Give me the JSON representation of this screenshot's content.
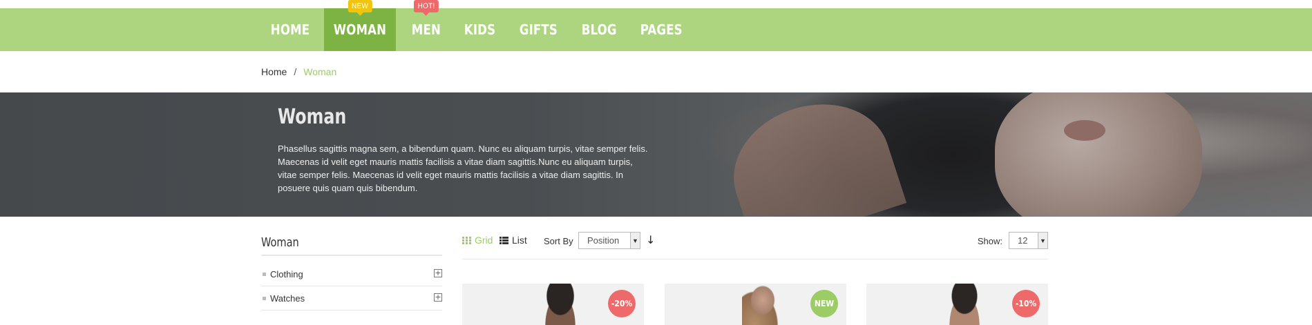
{
  "nav": {
    "items": [
      {
        "label": "HOME",
        "badge": ""
      },
      {
        "label": "WOMAN",
        "badge": "NEW",
        "active": true
      },
      {
        "label": "MEN",
        "badge": "HOT!"
      },
      {
        "label": "KIDS",
        "badge": ""
      },
      {
        "label": "GIFTS",
        "badge": ""
      },
      {
        "label": "BLOG",
        "badge": ""
      },
      {
        "label": "PAGES",
        "badge": ""
      }
    ],
    "colors": {
      "bar": "#add580",
      "active": "#7cb342",
      "new_badge": "#f2c40a",
      "hot_badge": "#ee6a6a"
    }
  },
  "breadcrumb": {
    "home": "Home",
    "separator": "/",
    "current": "Woman"
  },
  "hero": {
    "title": "Woman",
    "text": "Phasellus sagittis magna sem, a bibendum quam. Nunc eu aliquam turpis, vitae semper felis. Maecenas id velit eget mauris mattis facilisis a vitae diam sagittis.Nunc eu aliquam turpis, vitae semper felis. Maecenas id velit eget mauris mattis facilisis a vitae diam sagittis. In posuere quis quam quis bibendum."
  },
  "sidebar": {
    "title": "Woman",
    "items": [
      {
        "label": "Clothing"
      },
      {
        "label": "Watches"
      }
    ]
  },
  "toolbar": {
    "grid_label": "Grid",
    "list_label": "List",
    "sort_label": "Sort By",
    "sort_value": "Position",
    "show_label": "Show:",
    "show_value": "12"
  },
  "products": [
    {
      "badge": "-20%",
      "badge_type": "sale"
    },
    {
      "badge": "NEW",
      "badge_type": "new"
    },
    {
      "badge": "-10%",
      "badge_type": "sale"
    }
  ],
  "accent_color": "#9ccc65"
}
